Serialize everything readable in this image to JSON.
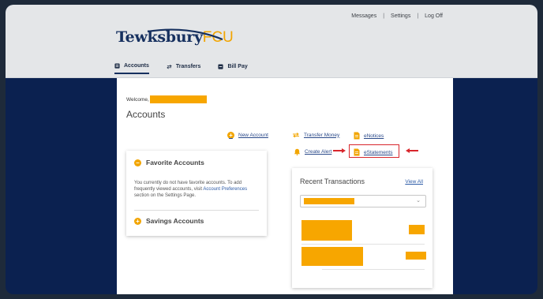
{
  "header": {
    "links": [
      "Messages",
      "Settings",
      "Log Off"
    ],
    "separator": "|",
    "logo": {
      "main": "Tewksbury",
      "accent": "FCU"
    }
  },
  "nav": {
    "items": [
      {
        "label": "Accounts",
        "icon": "accounts-icon",
        "active": true
      },
      {
        "label": "Transfers",
        "icon": "transfers-icon",
        "active": false
      },
      {
        "label": "Bill Pay",
        "icon": "bill-pay-icon",
        "active": false
      }
    ]
  },
  "main": {
    "welcome": "Welcome,",
    "heading": "Accounts",
    "actions": {
      "new_account": "New Account",
      "transfer_money": "Transfer Money",
      "enotices": "eNotices",
      "create_alert": "Create Alert",
      "estatements": "eStatements"
    },
    "favorites": {
      "title": "Favorite Accounts",
      "text_before": "You currently do not have favorite accounts. To add frequently viewed accounts, visit ",
      "link": "Account Preferences",
      "text_after": " section on the Settings Page.",
      "savings_title": "Savings Accounts"
    },
    "recent": {
      "title": "Recent Transactions",
      "view_all": "View All"
    }
  },
  "colors": {
    "brand_navy": "#16305f",
    "brand_gold": "#f2a500",
    "background_navy": "#0b2150",
    "highlight_red": "#d8262c",
    "redaction": "#f7a600"
  }
}
